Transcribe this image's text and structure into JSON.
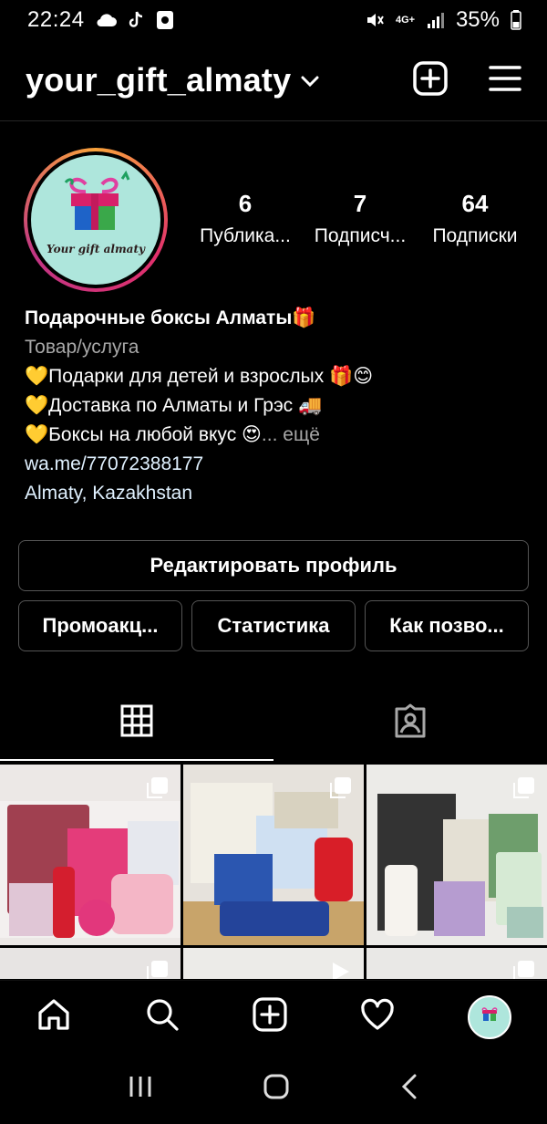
{
  "status_bar": {
    "time": "22:24",
    "network": "4G+",
    "battery": "35%",
    "left_icons": [
      "cloud-icon",
      "tiktok-icon",
      "screenshot-icon"
    ],
    "right_icons": [
      "mute-icon",
      "signal-icon",
      "battery-icon"
    ]
  },
  "header": {
    "username": "your_gift_almaty",
    "actions": [
      "new-post-icon",
      "menu-icon"
    ]
  },
  "profile": {
    "avatar_caption": "Your gift almaty",
    "stats": [
      {
        "value": "6",
        "label": "Публика..."
      },
      {
        "value": "7",
        "label": "Подписч..."
      },
      {
        "value": "64",
        "label": "Подписки"
      }
    ],
    "bio": {
      "name": "Подарочные боксы Алматы🎁",
      "category": "Товар/услуга",
      "line1": "💛Подарки для детей и взрослых 🎁😊",
      "line2": "💛Доставка по Алматы и Грэс 🚚",
      "line3": "💛Боксы на любой вкус 😍",
      "more": "... ещё",
      "link": "wa.me/77072388177",
      "location": "Almaty, Kazakhstan"
    }
  },
  "buttons": {
    "edit_profile": "Редактировать профиль",
    "promo": "Промоакц...",
    "stats": "Статистика",
    "how": "Как позво..."
  },
  "tabs": [
    "grid-icon",
    "tagged-icon"
  ],
  "colors": {
    "background": "#000000",
    "ring_start": "#f9a23b",
    "ring_mid": "#e1306c",
    "avatar_bg": "#aee6dc",
    "border": "#555555",
    "secondary_text": "#a8a8a8"
  },
  "bottom_nav": [
    "home-icon",
    "search-icon",
    "add-icon",
    "heart-icon",
    "profile-avatar"
  ],
  "system_nav": [
    "recents-icon",
    "home-button-icon",
    "back-icon"
  ]
}
